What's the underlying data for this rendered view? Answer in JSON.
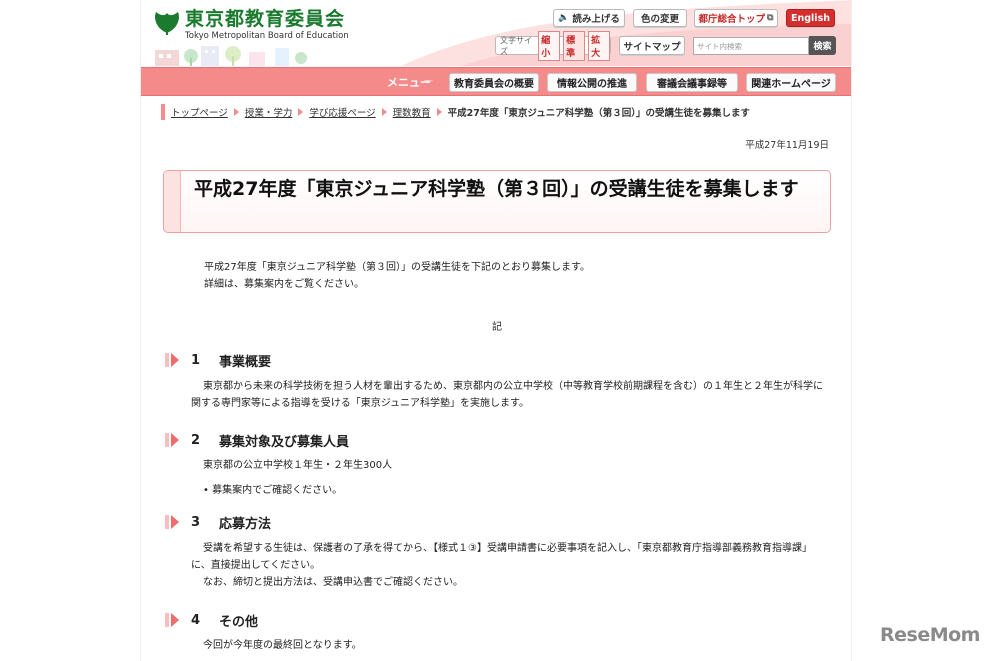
{
  "header": {
    "org_name_ja": "東京都教育委員会",
    "org_name_en": "Tokyo Metropolitan Board of Education",
    "read_aloud": "読み上げる",
    "color_change": "色の変更",
    "gov_top": "都庁総合トップ",
    "english": "English",
    "font_size_label": "文字サイズ",
    "font_small": "縮小",
    "font_standard": "標準",
    "font_large": "拡大",
    "sitemap": "サイトマップ",
    "search_placeholder": "サイト内検索",
    "search_button": "検索"
  },
  "menu": {
    "label": "メニュー",
    "items": [
      "教育委員会の概要",
      "情報公開の推進",
      "審議会議事録等",
      "関連ホームページ"
    ]
  },
  "breadcrumb": {
    "items": [
      "トップページ",
      "授業・学力",
      "学び応援ページ",
      "理数教育"
    ],
    "current": "平成27年度「東京ジュニア科学塾（第３回）」の受講生徒を募集します"
  },
  "date": "平成27年11月19日",
  "title": "平成27年度「東京ジュニア科学塾（第３回）」の受講生徒を募集します",
  "intro": {
    "line1": "平成27年度「東京ジュニア科学塾（第３回）」の受講生徒を下記のとおり募集します。",
    "line2": "詳細は、募集案内をご覧ください。"
  },
  "ki": "記",
  "sections": [
    {
      "num": "1",
      "title": "事業概要",
      "body": "東京都から未来の科学技術を担う人材を輩出するため、東京都内の公立中学校（中等教育学校前期課程を含む）の１年生と２年生が科学に関する専門家等による指導を受ける「東京ジュニア科学塾」を実施します。"
    },
    {
      "num": "2",
      "title": "募集対象及び募集人員",
      "body": "東京都の公立中学校１年生・２年生300人",
      "bullet": "募集案内でご確認ください。"
    },
    {
      "num": "3",
      "title": "応募方法",
      "body": "受講を希望する生徒は、保護者の了承を得てから、【様式１③】受講申請書に必要事項を記入し、「東京都教育庁指導部義務教育指導課」に、直接提出してください。",
      "body2": "なお、締切と提出方法は、受講申込書でご確認ください。"
    },
    {
      "num": "4",
      "title": "その他",
      "body": "今回が今年度の最終回となります。"
    }
  ],
  "watermark": "ReseMom",
  "colors": {
    "accent": "#f48a8a",
    "logo_green": "#1a7a2e",
    "english_red": "#d32f2f"
  }
}
